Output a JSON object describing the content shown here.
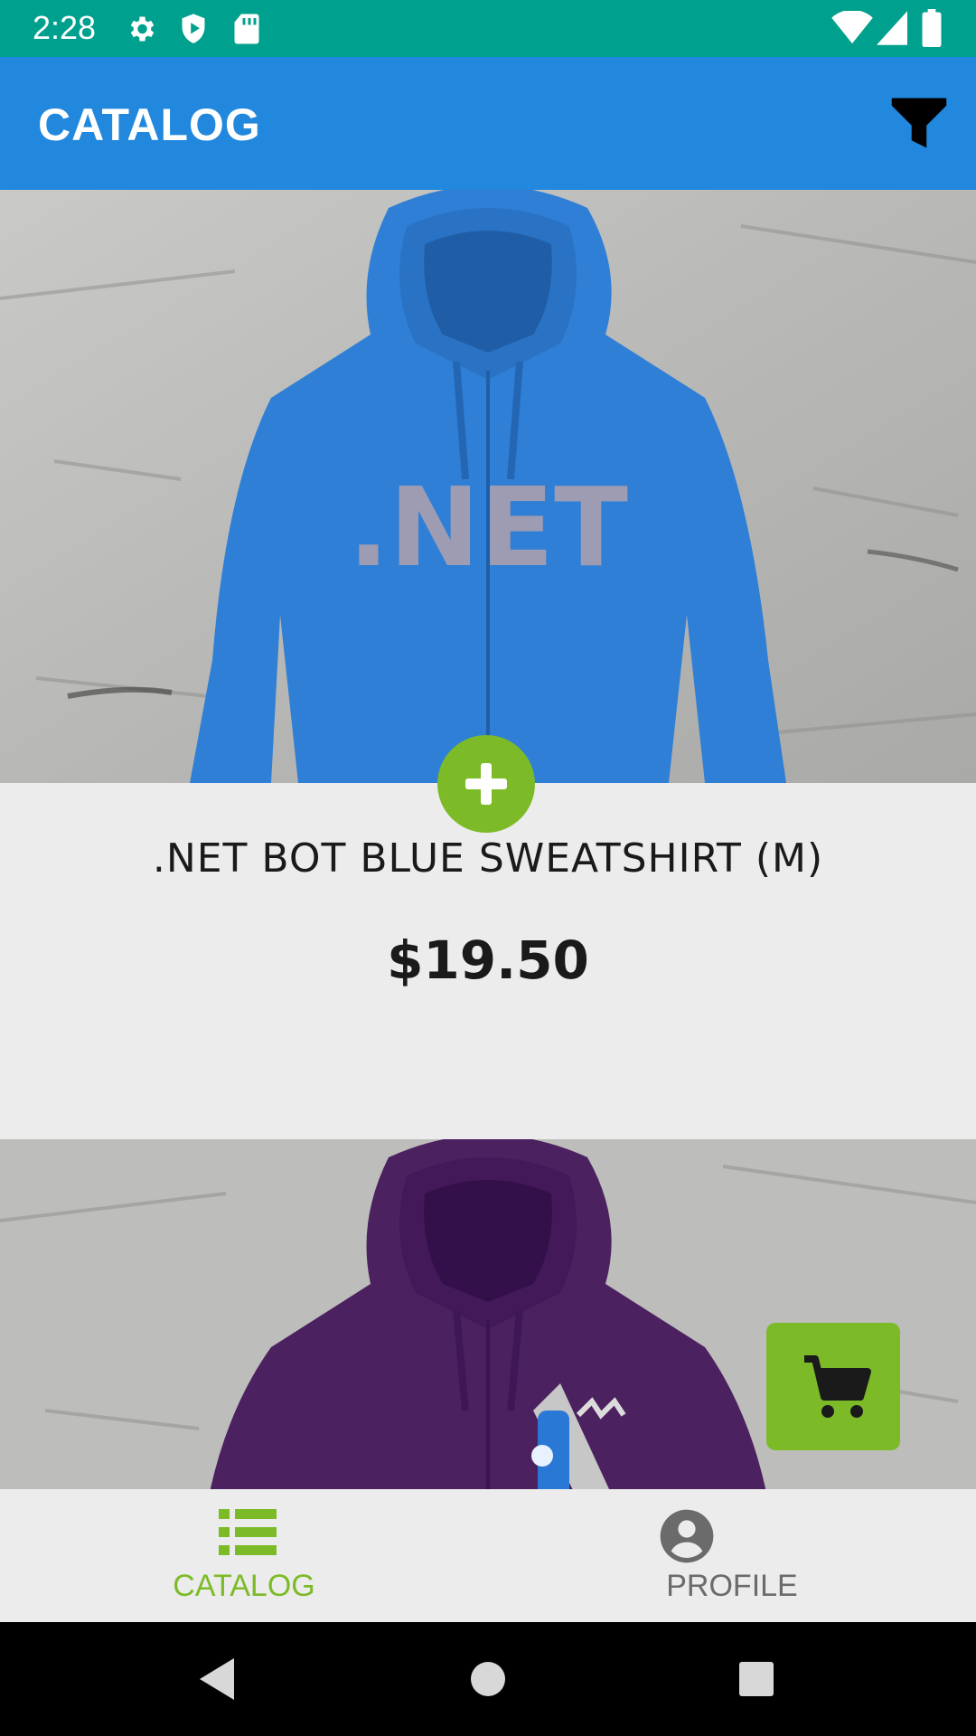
{
  "status_bar": {
    "time": "2:28",
    "icons": [
      "gear-icon",
      "shield-play-icon",
      "sd-card-icon",
      "wifi-icon",
      "signal-icon",
      "battery-icon"
    ],
    "background": "#00a08e"
  },
  "app_bar": {
    "title": "CATALOG",
    "filter_icon": "filter-icon",
    "background": "#2188dd"
  },
  "catalog": {
    "items": [
      {
        "name": ".NET BOT BLUE SWEATSHIRT (M)",
        "price": "$19.50",
        "image": "blue-hoodie-net-logo",
        "image_text": ".NET",
        "color": "#2f7fd6"
      },
      {
        "name": "",
        "price": "",
        "image": "purple-hoodie",
        "color": "#4c2160"
      }
    ]
  },
  "actions": {
    "add_icon": "plus-icon",
    "cart_icon": "cart-icon",
    "accent": "#7cbb27"
  },
  "bottom_nav": {
    "items": [
      {
        "label": "CATALOG",
        "icon": "list-icon",
        "active": true
      },
      {
        "label": "PROFILE",
        "icon": "account-circle-icon",
        "active": false
      }
    ]
  },
  "system_nav": {
    "buttons": [
      "back-icon",
      "home-icon",
      "recents-icon"
    ]
  }
}
